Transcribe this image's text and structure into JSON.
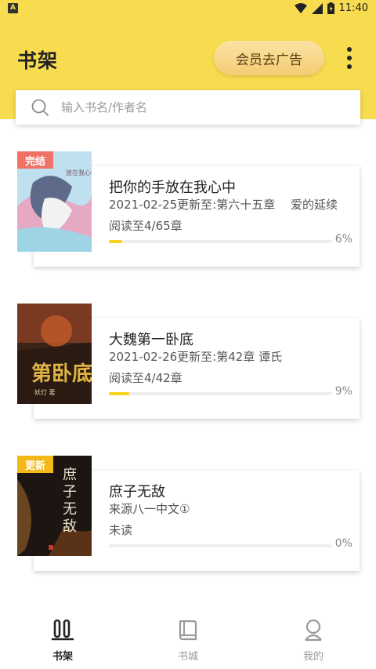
{
  "status_bar": {
    "time": "11:40",
    "app_badge": "A"
  },
  "header": {
    "title": "书架",
    "vip_button": "会员去广告"
  },
  "search": {
    "placeholder": "输入书名/作者名"
  },
  "books": [
    {
      "title": "把你的手放在我心中",
      "meta": "2021-02-25更新至:第六十五章　 爱的延续",
      "progress_text": "阅读至4/65章",
      "percent": "6%",
      "progress": 0.06,
      "badge": "完结",
      "badge_color": "#f07166"
    },
    {
      "title": "大魏第一卧底",
      "meta": "2021-02-26更新至:第42章 谭氏",
      "progress_text": "阅读至4/42章",
      "percent": "9%",
      "progress": 0.09,
      "badge": "",
      "badge_color": ""
    },
    {
      "title": "庶子无敌",
      "meta": "来源八一中文①",
      "progress_text": "未读",
      "percent": "0%",
      "progress": 0.0,
      "badge": "更新",
      "badge_color": "#f3b81a"
    }
  ],
  "bottom_nav": [
    {
      "label": "书架",
      "icon": "bookshelf-icon",
      "active": true
    },
    {
      "label": "书城",
      "icon": "book-icon",
      "active": false
    },
    {
      "label": "我的",
      "icon": "user-icon",
      "active": false
    }
  ],
  "colors": {
    "accent": "#f8dc4f",
    "progress": "#f5d21f"
  }
}
